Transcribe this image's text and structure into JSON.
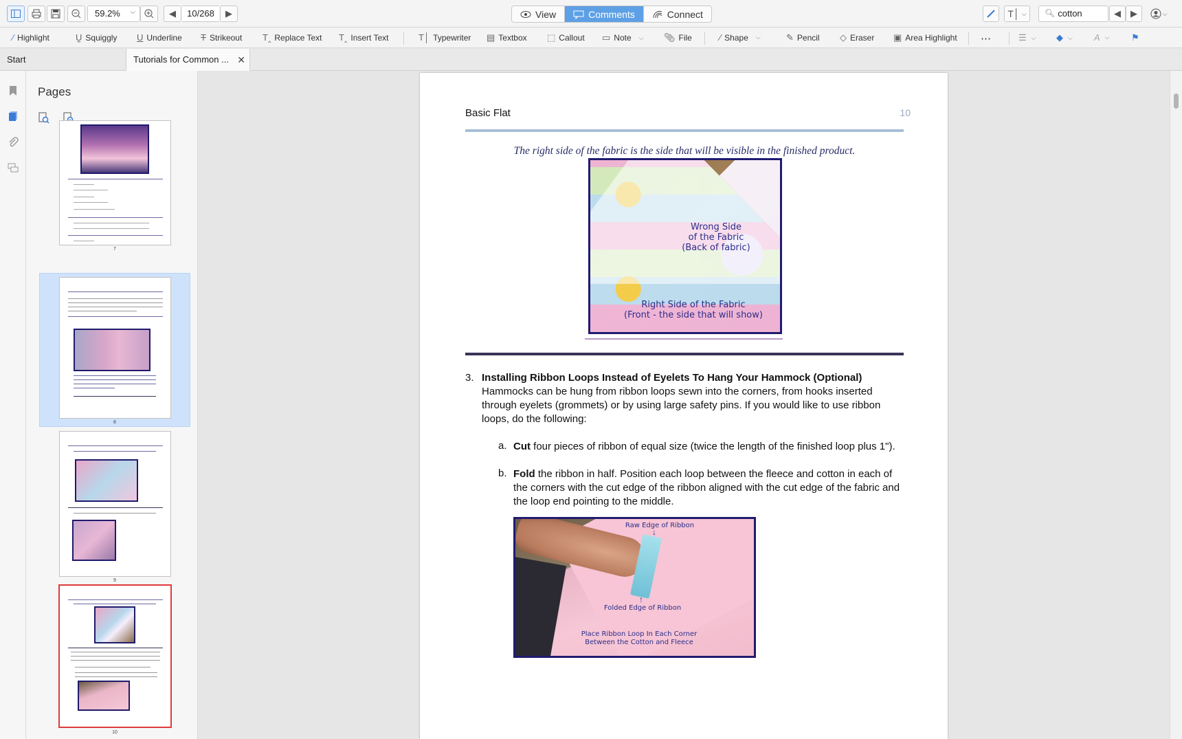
{
  "toolbar": {
    "zoom": "59.2%",
    "page_indicator": "10/268",
    "modes": [
      "View",
      "Comments",
      "Connect"
    ],
    "active_mode": "Comments",
    "search_value": "cotton"
  },
  "annotation_tools": [
    "Highlight",
    "Squiggly",
    "Underline",
    "Strikeout",
    "Replace Text",
    "Insert Text",
    "Typewriter",
    "Textbox",
    "Callout",
    "Note",
    "File",
    "Shape",
    "Pencil",
    "Eraser",
    "Area Highlight"
  ],
  "tabs": [
    "Start",
    "Tutorials for Common ..."
  ],
  "pages_panel": {
    "title": "Pages",
    "thumbnail_numbers": [
      "7",
      "8",
      "9",
      "10"
    ],
    "selected_page": "8",
    "current_page": "10"
  },
  "document": {
    "header_left": "Basic Flat",
    "header_page": "10",
    "caption": "The right side of the fabric is the side that will be visible in the finished product.",
    "photo1_labels": {
      "wrong_side": "Wrong Side\nof the Fabric\n(Back of fabric)",
      "right_side": "Right Side of the Fabric\n(Front - the side that will show)"
    },
    "step_number": "3.",
    "step_title": "Installing Ribbon Loops Instead of Eyelets To Hang Your Hammock (Optional)",
    "step_body": "Hammocks can be hung from ribbon loops sewn into the corners, from hooks inserted through eyelets (grommets) or by using large safety pins. If you would like to use ribbon loops, do the following:",
    "sub_a_letter": "a.",
    "sub_a_bold": "Cut",
    "sub_a_text": " four pieces of ribbon of equal size (twice the length of the finished loop plus 1\").",
    "sub_b_letter": "b.",
    "sub_b_bold": "Fold",
    "sub_b_text": " the ribbon in half. Position each loop between the fleece and cotton in each of the corners with the cut edge of the ribbon aligned with the cut edge of the fabric and the loop end pointing to the middle.",
    "photo2_labels": {
      "raw_edge": "Raw Edge of Ribbon",
      "folded_edge": "Folded Edge of Ribbon",
      "place": "Place Ribbon Loop In Each Corner\nBetween the Cotton and Fleece"
    }
  },
  "colors": {
    "accent": "#5ea0e6",
    "caption_text": "#262b66",
    "photo_border": "#201b70",
    "current_page_border": "#e03a3a"
  }
}
